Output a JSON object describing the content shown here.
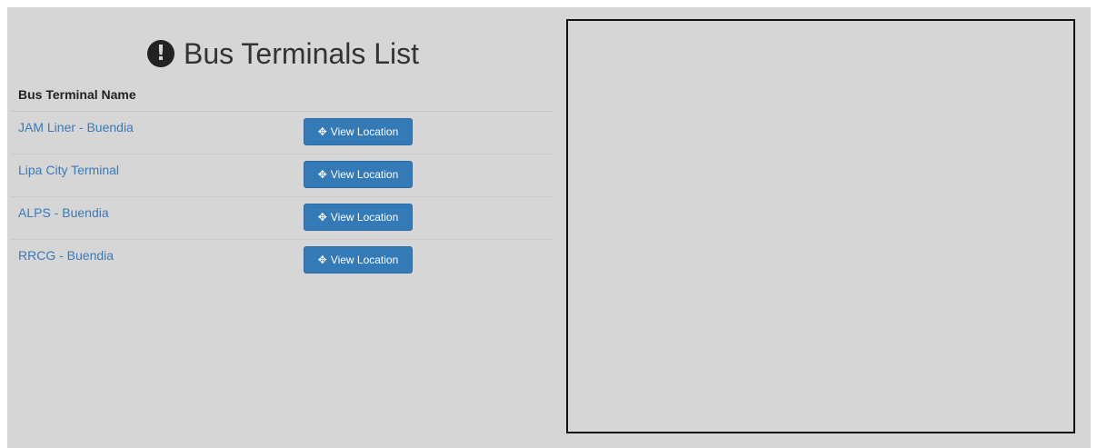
{
  "header": {
    "title": "Bus Terminals List",
    "icon": "exclamation-circle-icon"
  },
  "table": {
    "column_header": "Bus Terminal Name",
    "button_label": "View Location",
    "button_icon": "move-arrows-icon",
    "rows": [
      {
        "name": "JAM Liner - Buendia"
      },
      {
        "name": "Lipa City Terminal"
      },
      {
        "name": "ALPS - Buendia"
      },
      {
        "name": "RRCG - Buendia"
      }
    ]
  },
  "colors": {
    "background": "#d6d6d6",
    "link": "#3a7ab8",
    "button": "#337ab7",
    "map_border": "#111111"
  }
}
